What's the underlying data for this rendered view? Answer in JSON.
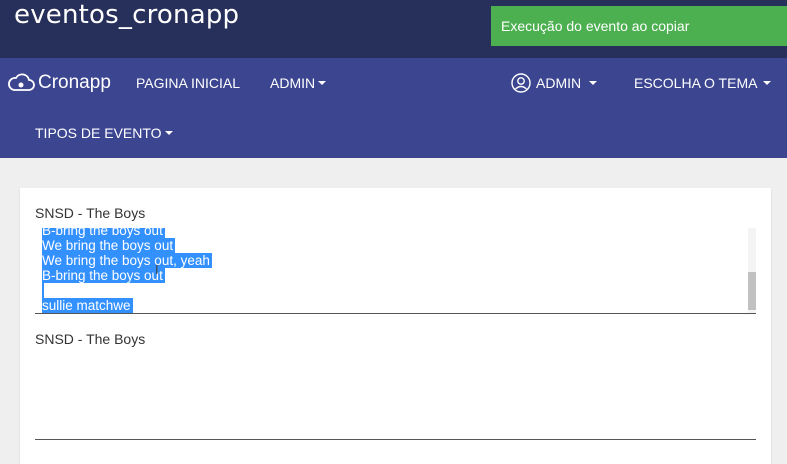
{
  "app": {
    "title": "eventos_cronapp"
  },
  "toast": {
    "message": "Execução do evento ao copiar"
  },
  "navbar": {
    "brand": "Cronapp",
    "items": [
      {
        "label": "PAGINA INICIAL"
      },
      {
        "label": "ADMIN"
      },
      {
        "label": "TIPOS DE EVENTO"
      }
    ],
    "user_menu": {
      "label": "ADMIN"
    },
    "theme_menu": {
      "label": "ESCOLHA O TEMA"
    }
  },
  "form": {
    "field1": {
      "label": "SNSD - The Boys",
      "lines": [
        "B-bring the boys out",
        "We bring the boys out",
        "We bring the boys out, yeah",
        "B-bring the boys out",
        " ",
        "sullie matchwe"
      ]
    },
    "field2": {
      "label": "SNSD - The Boys",
      "value": ""
    }
  },
  "colors": {
    "titlebar": "#27305a",
    "navbar": "#3c4590",
    "toast": "#4caf50",
    "selection": "#3390ff"
  },
  "icons": {
    "brand": "cloud-icon",
    "user": "user-circle-icon",
    "dropdown": "caret-down-icon"
  }
}
